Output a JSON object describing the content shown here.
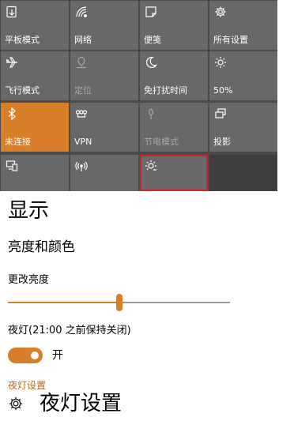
{
  "action_center": {
    "tiles": [
      {
        "label": "平板模式",
        "icon": "tablet-mode-icon",
        "state": "off"
      },
      {
        "label": "网络",
        "icon": "network-icon",
        "state": "off"
      },
      {
        "label": "便笺",
        "icon": "note-icon",
        "state": "off"
      },
      {
        "label": "所有设置",
        "icon": "gear-icon",
        "state": "off"
      },
      {
        "label": "飞行模式",
        "icon": "airplane-icon",
        "state": "off"
      },
      {
        "label": "定位",
        "icon": "location-icon",
        "state": "disabled"
      },
      {
        "label": "免打扰时间",
        "icon": "moon-icon",
        "state": "off"
      },
      {
        "label": "50%",
        "icon": "brightness-icon",
        "state": "off"
      },
      {
        "label": "未连接",
        "icon": "bluetooth-icon",
        "state": "on"
      },
      {
        "label": "VPN",
        "icon": "vpn-icon",
        "state": "off"
      },
      {
        "label": "节电模式",
        "icon": "battery-saver-icon",
        "state": "disabled"
      },
      {
        "label": "投影",
        "icon": "project-icon",
        "state": "off"
      },
      {
        "label": "",
        "icon": "connect-icon",
        "state": "off"
      },
      {
        "label": "",
        "icon": "hotspot-icon",
        "state": "off"
      },
      {
        "label": "",
        "icon": "night-light-icon",
        "state": "selected"
      },
      {
        "label": "",
        "icon": "",
        "state": "empty"
      }
    ]
  },
  "display": {
    "title": "显示",
    "section": "亮度和颜色",
    "brightness_label": "更改亮度",
    "brightness_value": 0.5,
    "night_light_label": "夜灯(21:00 之前保持关闭)",
    "night_light_state": "开",
    "night_light_link": "夜灯设置",
    "night_light_settings_label": "夜灯设置"
  },
  "colors": {
    "accent": "#d97e28",
    "tile": "#686868",
    "highlight": "#c8282a"
  }
}
